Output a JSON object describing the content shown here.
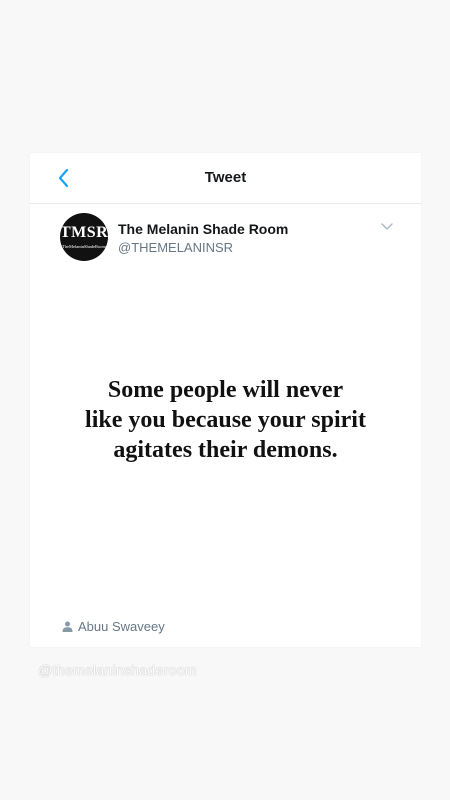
{
  "header": {
    "title": "Tweet"
  },
  "account": {
    "name": "The Melanin Shade Room",
    "handle": "@THEMELANINSR",
    "avatar_text": "TMSR",
    "avatar_subtext": "TheMelaninShadeRoom"
  },
  "quote": {
    "lines": [
      "Some people will never",
      "like you because your spirit",
      "agitates their demons."
    ]
  },
  "author": {
    "name": "Abuu Swaveey"
  },
  "watermark": {
    "text": "@themelaninshaderoom"
  },
  "colors": {
    "accent": "#1da1f2",
    "secondary_text": "#657786",
    "primary_text": "#14171a",
    "background": "#f8f8f8"
  },
  "icons": [
    "back-chevron-icon",
    "chevron-down-icon",
    "person-icon"
  ]
}
